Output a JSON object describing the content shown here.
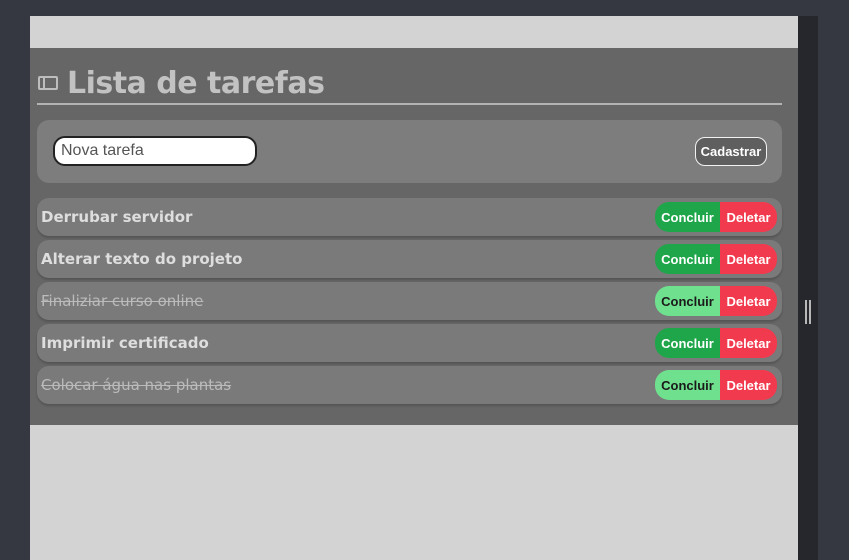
{
  "header": {
    "title": "Lista de tarefas",
    "icon": "window-icon"
  },
  "form": {
    "input_placeholder": "Nova tarefa",
    "input_value": "",
    "submit_label": "Cadastrar"
  },
  "tasks": [
    {
      "text": "Derrubar servidor",
      "done": false,
      "complete_label": "Concluir",
      "delete_label": "Deletar"
    },
    {
      "text": "Alterar texto do projeto",
      "done": false,
      "complete_label": "Concluir",
      "delete_label": "Deletar"
    },
    {
      "text": "Finaliziar curso online",
      "done": true,
      "complete_label": "Concluir",
      "delete_label": "Deletar"
    },
    {
      "text": "Imprimir certificado",
      "done": false,
      "complete_label": "Concluir",
      "delete_label": "Deletar"
    },
    {
      "text": "Colocar água nas plantas",
      "done": true,
      "complete_label": "Concluir",
      "delete_label": "Deletar"
    }
  ],
  "colors": {
    "page_bg": "#d3d3d3",
    "container_bg": "#666666",
    "complete_active": "#1fa64a",
    "complete_done": "#6ee08e",
    "delete": "#f23a4e"
  }
}
